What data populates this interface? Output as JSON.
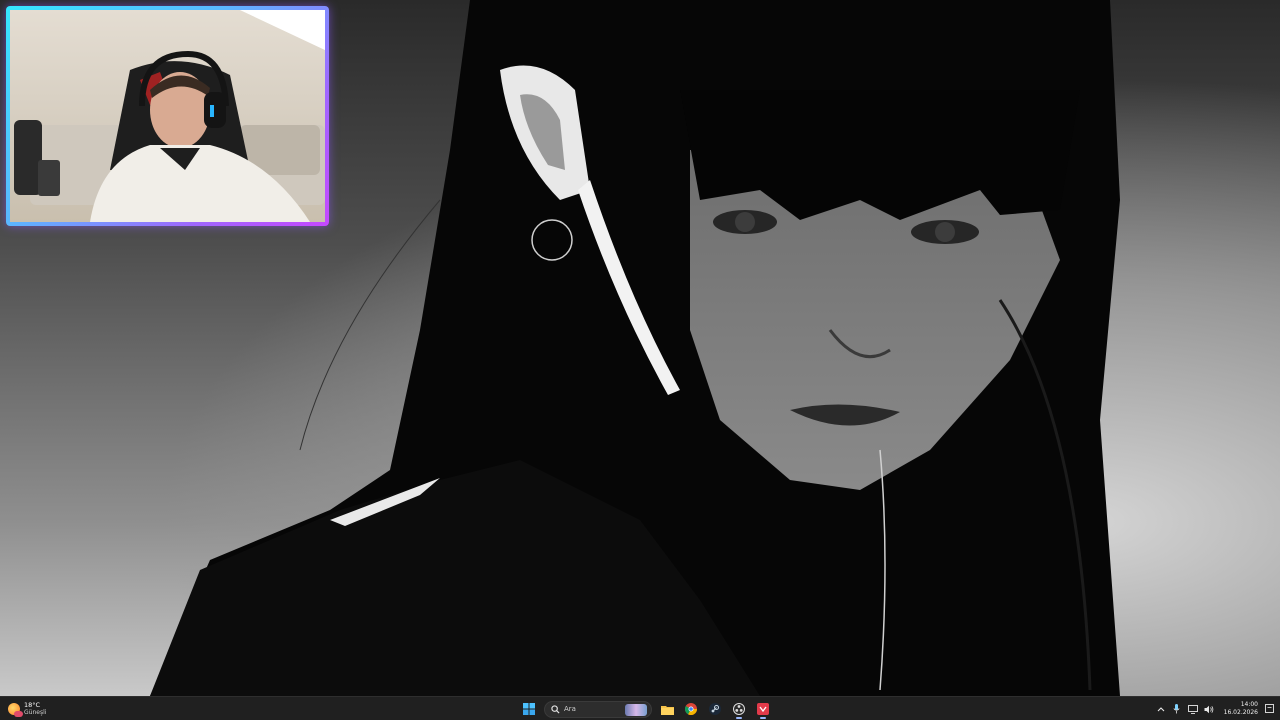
{
  "webcam": {
    "border_colors": [
      "#35e6ff",
      "#c548ff"
    ]
  },
  "taskbar": {
    "weather": {
      "temperature": "18°C",
      "condition": "Güneşli",
      "icon": "sun-cloud-icon"
    },
    "search": {
      "label": "Ara",
      "icon": "search-icon"
    },
    "pinned_apps": [
      {
        "name": "start",
        "icon": "windows-logo-icon"
      },
      {
        "name": "file-explorer",
        "icon": "folder-icon"
      },
      {
        "name": "chrome",
        "icon": "chrome-icon"
      },
      {
        "name": "steam",
        "icon": "steam-icon"
      },
      {
        "name": "obs",
        "icon": "obs-icon"
      },
      {
        "name": "app-red",
        "icon": "red-app-icon"
      }
    ],
    "tray": [
      "chevron-up-icon",
      "microphone-icon",
      "network-icon",
      "volume-icon"
    ],
    "clock": {
      "time": "14:00",
      "date": "16.02.2026"
    },
    "accent_color": "#202020"
  }
}
